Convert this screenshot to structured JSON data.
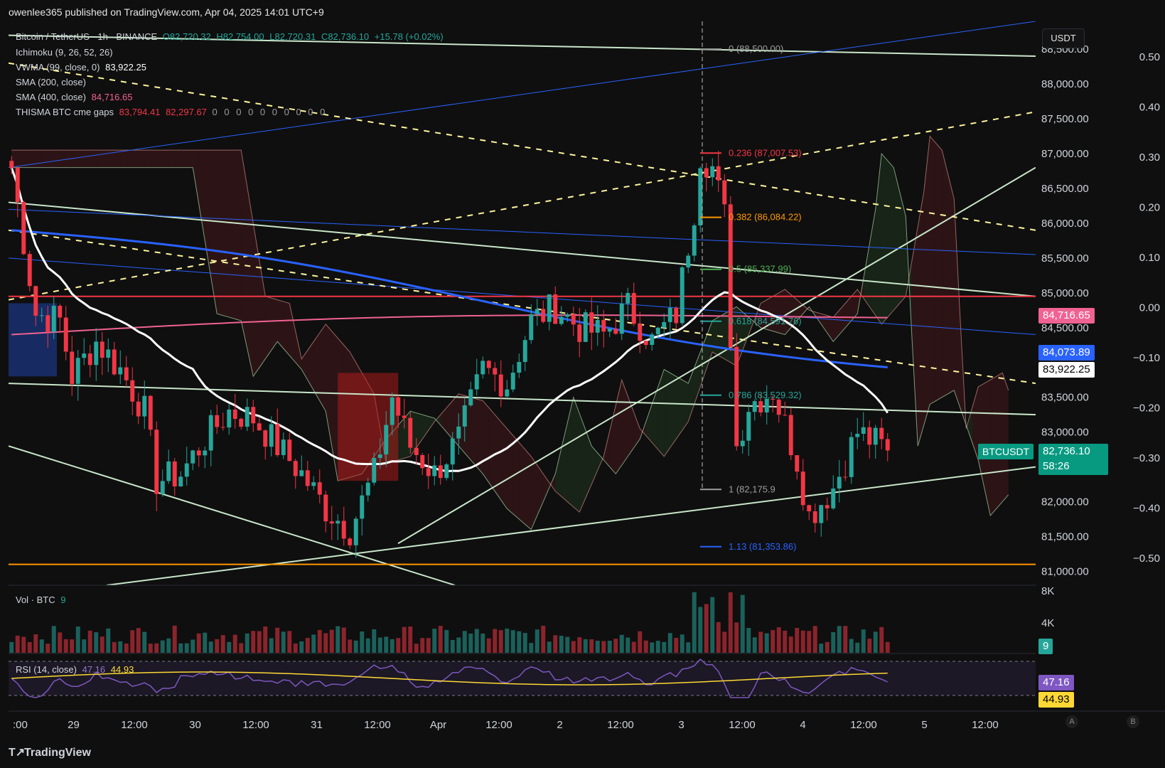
{
  "publisher": "owenlee365 published on TradingView.com, Apr 04, 2025 14:01 UTC+9",
  "legend": {
    "symbol": "Bitcoin / TetherUS · 1h · BINANCE",
    "open": "O82,720.32",
    "high": "H82,754.00",
    "low": "L82,720.31",
    "close": "C82,736.10",
    "change": "+15.78 (+0.02%)",
    "ichimoku": "Ichimoku (9, 26, 52, 26)",
    "vwma_label": "VWMA (99, close, 0)",
    "vwma_value": "83,922.25",
    "sma200_label": "SMA (200, close)",
    "sma400_label": "SMA (400, close)",
    "sma400_value": "84,716.65",
    "cme_label": "THISMA BTC cme gaps",
    "cme_v1": "83,794.41",
    "cme_v2": "82,297.67",
    "cme_zeros": "0 0 0 0 0 0 0 0 0 0",
    "vol_label": "Vol · BTC",
    "vol_value": "9",
    "rsi_label": "RSI (14, close)",
    "rsi_value": "47.16",
    "rsi_ma_value": "44.93"
  },
  "currency": "USDT",
  "price_axis": [
    "88,500.00",
    "88,000.00",
    "87,500.00",
    "87,000.00",
    "86,500.00",
    "86,000.00",
    "85,500.00",
    "85,000.00",
    "84,500.00",
    "83,500.00",
    "83,000.00",
    "82,000.00",
    "81,500.00",
    "81,000.00"
  ],
  "fib_axis": [
    "0.50",
    "0.40",
    "0.30",
    "0.20",
    "0.10",
    "0.00",
    "−0.10",
    "−0.20",
    "−0.30",
    "−0.40",
    "−0.50"
  ],
  "vol_axis": [
    "8K",
    "4K"
  ],
  "price_labels": {
    "sma400": "84,716.65",
    "sma200": "84,073.89",
    "vwma": "83,922.25",
    "symbol": "BTCUSDT",
    "last": "82,736.10",
    "countdown": "58:26",
    "vol": "9",
    "rsi": "47.16",
    "rsi_ma": "44.93"
  },
  "time_axis": [
    ":00",
    "29",
    "12:00",
    "30",
    "12:00",
    "31",
    "12:00",
    "Apr",
    "12:00",
    "2",
    "12:00",
    "3",
    "12:00",
    "4",
    "12:00",
    "5",
    "12:00"
  ],
  "fib_levels": [
    "0 (88,500.00)",
    "0.236 (87,007.53)",
    "0.382 (86,084.22)",
    "0.5 (85,337.99)",
    "0.618 (84,591.76)",
    "0.786 (83,529.32)",
    "1 (82,175.9",
    "1.13 (81,353.86)"
  ],
  "footer": {
    "brand": "TradingView",
    "btn_a": "A",
    "btn_b": "B"
  },
  "colors": {
    "up": "#26a69a",
    "down": "#f23645",
    "sma200": "#2962ff",
    "sma400": "#f06292",
    "vwma": "#ffffff",
    "rsi": "#7e57c2",
    "rsi_ma": "#fdd835"
  },
  "chart_data": {
    "type": "candlestick",
    "title": "Bitcoin / TetherUS · 1h · BINANCE",
    "y_range": [
      80800,
      88900
    ],
    "x_ticks": [
      ":00",
      "29",
      "12:00",
      "30",
      "12:00",
      "31",
      "12:00",
      "Apr",
      "12:00",
      "2",
      "12:00",
      "3",
      "12:00",
      "4",
      "12:00",
      "5",
      "12:00"
    ],
    "close_path_approx": [
      [
        0,
        86800
      ],
      [
        4,
        84700
      ],
      [
        8,
        84600
      ],
      [
        10,
        83800
      ],
      [
        14,
        84300
      ],
      [
        18,
        83900
      ],
      [
        22,
        83300
      ],
      [
        24,
        82300
      ],
      [
        28,
        82400
      ],
      [
        32,
        82900
      ],
      [
        36,
        83300
      ],
      [
        40,
        83200
      ],
      [
        44,
        82800
      ],
      [
        48,
        82400
      ],
      [
        52,
        81900
      ],
      [
        56,
        81600
      ],
      [
        60,
        82400
      ],
      [
        63,
        83500
      ],
      [
        66,
        82800
      ],
      [
        70,
        82400
      ],
      [
        74,
        82900
      ],
      [
        78,
        83900
      ],
      [
        82,
        83700
      ],
      [
        86,
        84600
      ],
      [
        90,
        84800
      ],
      [
        94,
        84500
      ],
      [
        98,
        84400
      ],
      [
        102,
        84800
      ],
      [
        106,
        84300
      ],
      [
        110,
        84700
      ],
      [
        113,
        86200
      ],
      [
        114,
        87000
      ],
      [
        116,
        86800
      ],
      [
        118,
        86100
      ],
      [
        119,
        84400
      ],
      [
        120,
        82800
      ],
      [
        122,
        83400
      ],
      [
        126,
        83600
      ],
      [
        130,
        82600
      ],
      [
        132,
        81800
      ],
      [
        136,
        82200
      ],
      [
        140,
        83000
      ],
      [
        142,
        82900
      ],
      [
        145,
        82736.1
      ]
    ],
    "last": 82736.1,
    "sma400": 84716.65,
    "sma200": 84073.89,
    "vwma": 83922.25,
    "rsi": 47.16,
    "rsi_ma": 44.93,
    "volume_last": 9
  }
}
